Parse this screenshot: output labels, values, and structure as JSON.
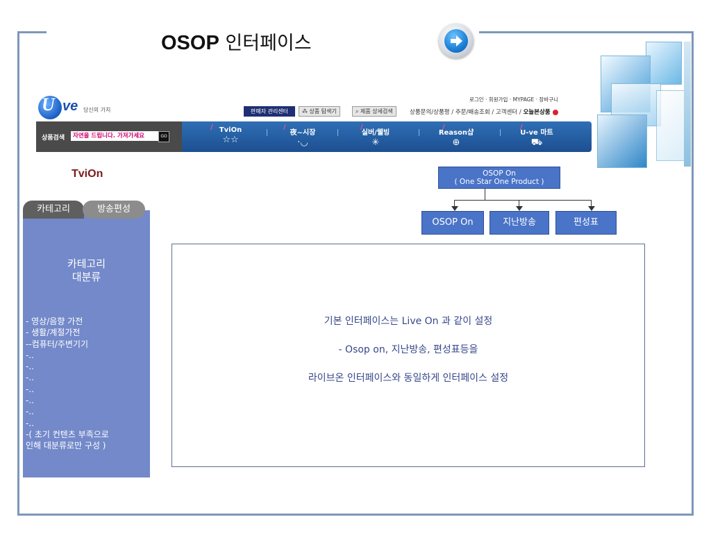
{
  "slide": {
    "title_bold": "OSOP",
    "title_rest": " 인터페이스"
  },
  "header": {
    "logo_u": "U",
    "logo_ve": "ve",
    "logo_tagline": "당신의 가치",
    "util_links": "로그인  ·  회원가입  · MYPAGE  · 장바구니",
    "seller_center": "판매자 관리센터",
    "product_search_btn": "상품 탐색기",
    "detail_search_btn": "제품 상세검색",
    "nav_links": "상품문의/상품평  /  주문/배송조회  /  고객센터  /",
    "today_product": "오늘본상품"
  },
  "search": {
    "label": "상품검색",
    "value": "자연을 드립니다. 가져가세요 ",
    "go": "GO"
  },
  "menu": [
    {
      "label": "TviOn",
      "icon": "☆☆"
    },
    {
      "label": "夜~시장",
      "icon": "·◡"
    },
    {
      "label": "실버/웰빙",
      "icon": "✳"
    },
    {
      "label": "Reason샵",
      "icon": "⊕"
    },
    {
      "label": "U-ve 마트",
      "icon": "⛟"
    }
  ],
  "page_label": "TviOn",
  "sidebar": {
    "tab_category": "카테고리",
    "tab_schedule": "방송편성",
    "heading_line1": "카테고리",
    "heading_line2": "대분류",
    "items": [
      "- 영상/음향 가전",
      "- 생활/계절가전",
      "--컴퓨터/주변기기",
      "-..",
      "-..",
      "-..",
      "-..",
      "-..",
      "-..",
      "-..",
      "-( 초기 컨텐츠 부족으로",
      "인해 대분류로만 구성 )"
    ]
  },
  "flow": {
    "top_line1": "OSOP  On",
    "top_line2": "( One Star One Product )",
    "box1": "OSOP On",
    "box2": "지난방송",
    "box3": "편성표"
  },
  "content": {
    "line1": "기본 인터페이스는 Live On 과 같이 설정",
    "line2": "- Osop on, 지난방송, 편성표등을",
    "line3": "라이브온 인터페이스와 동일하게 인터페이스 설정"
  },
  "colors": {
    "frame": "#7d97b8",
    "sidebar": "#7389c9",
    "flow_box": "#4a74c8",
    "menu_bar": "#2f6fb5",
    "content_text": "#37478a"
  }
}
